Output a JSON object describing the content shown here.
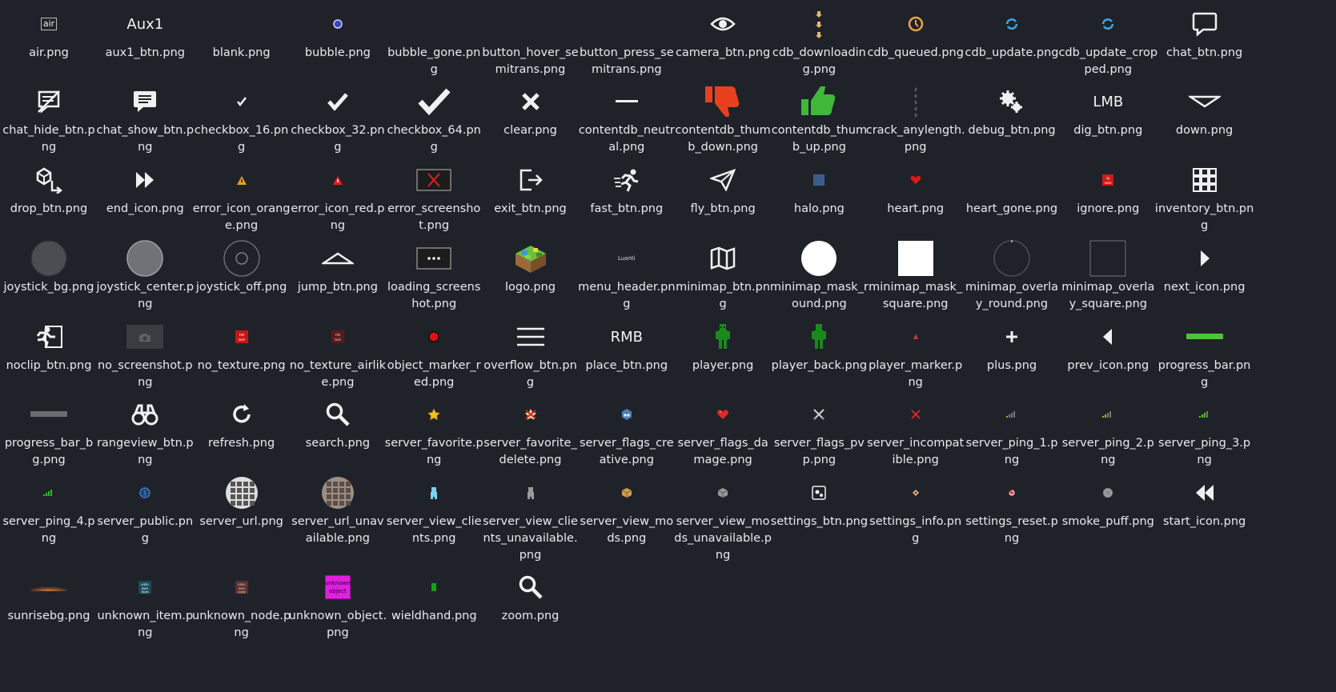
{
  "files": [
    "air.png",
    "aux1_btn.png",
    "blank.png",
    "bubble.png",
    "bubble_gone.png",
    "button_hover_semitrans.png",
    "button_press_semitrans.png",
    "camera_btn.png",
    "cdb_downloading.png",
    "cdb_queued.png",
    "cdb_update.png",
    "cdb_update_cropped.png",
    "chat_btn.png",
    "chat_hide_btn.png",
    "chat_show_btn.png",
    "checkbox_16.png",
    "checkbox_32.png",
    "checkbox_64.png",
    "clear.png",
    "contentdb_neutral.png",
    "contentdb_thumb_down.png",
    "contentdb_thumb_up.png",
    "crack_anylength.png",
    "debug_btn.png",
    "dig_btn.png",
    "down.png",
    "drop_btn.png",
    "end_icon.png",
    "error_icon_orange.png",
    "error_icon_red.png",
    "error_screenshot.png",
    "exit_btn.png",
    "fast_btn.png",
    "fly_btn.png",
    "halo.png",
    "heart.png",
    "heart_gone.png",
    "ignore.png",
    "inventory_btn.png",
    "joystick_bg.png",
    "joystick_center.png",
    "joystick_off.png",
    "jump_btn.png",
    "loading_screenshot.png",
    "logo.png",
    "menu_header.png",
    "minimap_btn.png",
    "minimap_mask_round.png",
    "minimap_mask_square.png",
    "minimap_overlay_round.png",
    "minimap_overlay_square.png",
    "next_icon.png",
    "noclip_btn.png",
    "no_screenshot.png",
    "no_texture.png",
    "no_texture_airlike.png",
    "object_marker_red.png",
    "overflow_btn.png",
    "place_btn.png",
    "player.png",
    "player_back.png",
    "player_marker.png",
    "plus.png",
    "prev_icon.png",
    "progress_bar.png",
    "progress_bar_bg.png",
    "rangeview_btn.png",
    "refresh.png",
    "search.png",
    "server_favorite.png",
    "server_favorite_delete.png",
    "server_flags_creative.png",
    "server_flags_damage.png",
    "server_flags_pvp.png",
    "server_incompatible.png",
    "server_ping_1.png",
    "server_ping_2.png",
    "server_ping_3.png",
    "server_ping_4.png",
    "server_public.png",
    "server_url.png",
    "server_url_unavailable.png",
    "server_view_clients.png",
    "server_view_clients_unavailable.png",
    "server_view_mods.png",
    "server_view_mods_unavailable.png",
    "settings_btn.png",
    "settings_info.png",
    "settings_reset.png",
    "smoke_puff.png",
    "start_icon.png",
    "sunrisebg.png",
    "unknown_item.png",
    "unknown_node.png",
    "unknown_object.png",
    "wieldhand.png",
    "zoom.png"
  ],
  "icon_text": {
    "air": "air",
    "aux1": "Aux1",
    "dig": "LMB",
    "place": "RMB",
    "menu_header": "Luanti"
  },
  "colors": {
    "background": "#1f2329",
    "text": "#e8eaed",
    "thumb_down": "#e8401c",
    "thumb_up": "#3fb83a",
    "accent_blue": "#3aa9e0",
    "player_green": "#1a8a1a"
  }
}
